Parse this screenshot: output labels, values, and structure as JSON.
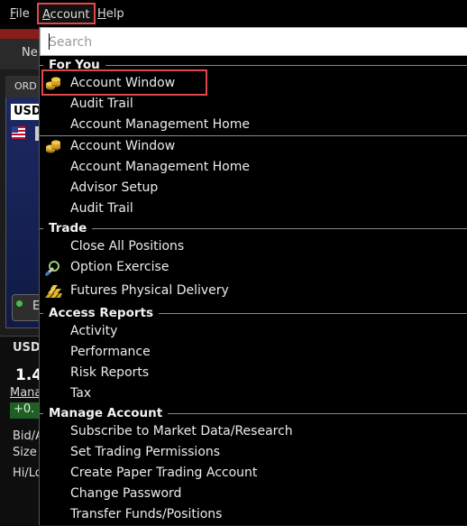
{
  "menubar": {
    "file": {
      "hot": "F",
      "rest": "ile"
    },
    "account": {
      "hot": "A",
      "rest": "ccount"
    },
    "help": {
      "hot": "H",
      "rest": "elp"
    }
  },
  "background": {
    "toolbar_text": "Ne",
    "panel_title": "ORD",
    "currency": "USD",
    "lower_title": "USD",
    "price": "1.4",
    "manage_link": "Mana",
    "change": "+0.",
    "bid_ask": "Bid/A",
    "size": "Size",
    "hi_lo": "Hi/Lo",
    "button_char": "E"
  },
  "search": {
    "placeholder": "Search"
  },
  "sections": {
    "for_you": "For You",
    "trade": "Trade",
    "access_reports": "Access Reports",
    "manage_account": "Manage Account"
  },
  "for_you_items": [
    "Account Window",
    "Audit Trail",
    "Account Management Home"
  ],
  "account_items": [
    "Account Window",
    "Account Management Home",
    "Advisor Setup",
    "Audit Trail"
  ],
  "trade_items": [
    "Close All Positions",
    "Option Exercise",
    "Futures Physical Delivery"
  ],
  "report_items": [
    "Activity",
    "Performance",
    "Risk Reports",
    "Tax"
  ],
  "manage_items": [
    "Subscribe to Market Data/Research",
    "Set Trading Permissions",
    "Create Paper Trading Account",
    "Change Password",
    "Transfer Funds/Positions"
  ],
  "colors": {
    "highlight": "#e2474c",
    "menu_bg": "#000000",
    "gold_icon": "#d4a11e"
  }
}
